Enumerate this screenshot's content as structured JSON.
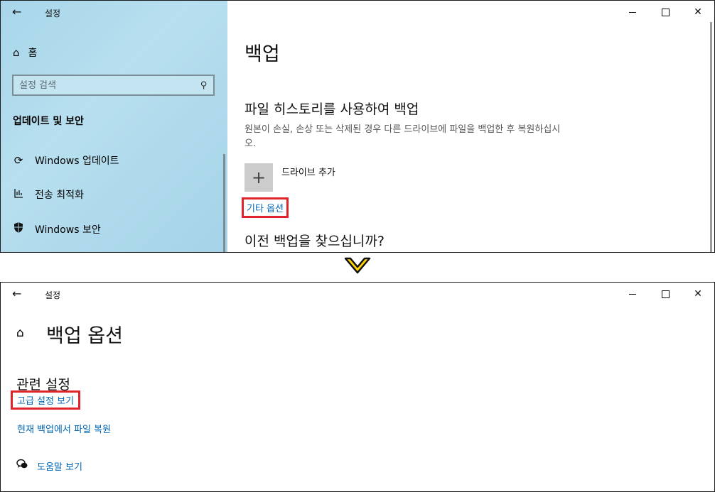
{
  "top_window": {
    "title": "설정",
    "home_label": "홈",
    "search_placeholder": "설정 검색",
    "section_title": "업데이트 및 보안",
    "nav_items": [
      {
        "label": "Windows 업데이트",
        "icon": "sync-icon"
      },
      {
        "label": "전송 최적화",
        "icon": "delivery-optimization-icon"
      },
      {
        "label": "Windows 보안",
        "icon": "shield-icon"
      }
    ],
    "page_title": "백업",
    "file_history_title": "파일 히스토리를 사용하여 백업",
    "file_history_desc": "원본이 손실, 손상 또는 삭제된 경우 다른 드라이브에 파일을 백업한 후 복원하십시오.",
    "add_drive_label": "드라이브 추가",
    "more_options_link": "기타 옵션",
    "older_backup_title": "이전 백업을 찾으십니까?"
  },
  "bottom_window": {
    "title": "설정",
    "page_title": "백업 옵션",
    "related_title": "관련 설정",
    "advanced_link": "고급 설정 보기",
    "restore_link": "현재 백업에서 파일 복원",
    "help_link": "도움말 보기"
  },
  "colors": {
    "sidebar_bg": "#a8d6ea",
    "link": "#0066b4",
    "highlight_box": "#e0242b",
    "chevron_fill": "#ffd400"
  }
}
